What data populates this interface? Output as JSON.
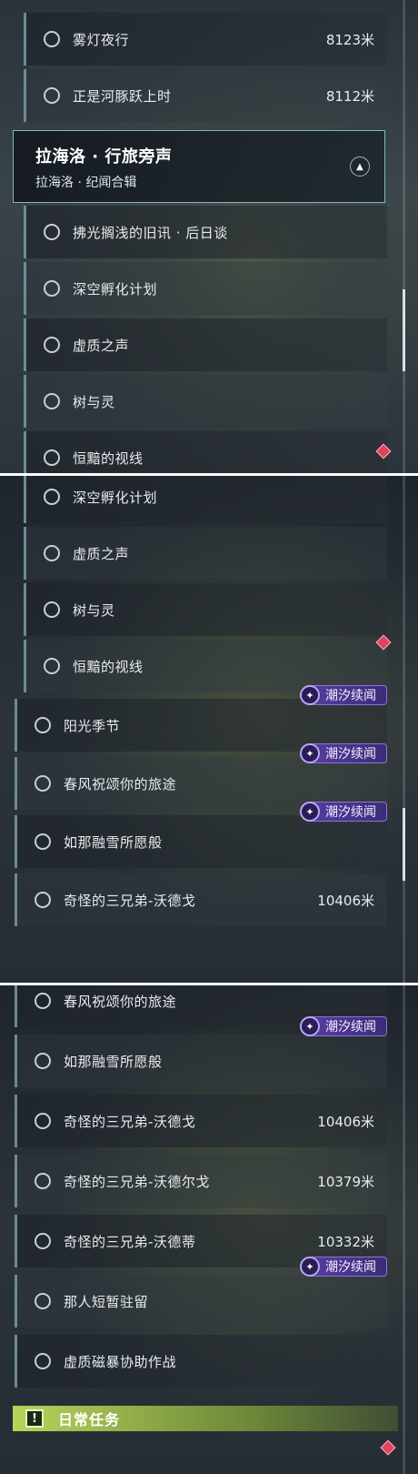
{
  "panel1": {
    "rows_top": [
      {
        "title": "雾灯夜行",
        "distance": "8123米"
      },
      {
        "title": "正是河豚跃上时",
        "distance": "8112米"
      }
    ],
    "section": {
      "title": "拉海洛 · 行旅旁声",
      "subtitle": "拉海洛 · 纪闻合辑"
    },
    "rows": [
      {
        "title": "拂光搁浅的旧讯 · 后日谈"
      },
      {
        "title": "深空孵化计划"
      },
      {
        "title": "虚质之声"
      },
      {
        "title": "树与灵"
      },
      {
        "title": "恒黯的视线"
      }
    ]
  },
  "panel2": {
    "rows": [
      {
        "title": "深空孵化计划"
      },
      {
        "title": "虚质之声"
      },
      {
        "title": "树与灵"
      },
      {
        "title": "恒黯的视线"
      }
    ],
    "quests": [
      {
        "title": "阳光季节",
        "badge": "潮汐续闻"
      },
      {
        "title": "春风祝颂你的旅途",
        "badge": "潮汐续闻"
      },
      {
        "title": "如那融雪所愿般",
        "badge": "潮汐续闻"
      },
      {
        "title": "奇怪的三兄弟-沃德戈",
        "distance": "10406米"
      }
    ]
  },
  "panel3": {
    "quests": [
      {
        "title": "春风祝颂你的旅途"
      },
      {
        "title": "如那融雪所愿般",
        "badge": "潮汐续闻"
      },
      {
        "title": "奇怪的三兄弟-沃德戈",
        "distance": "10406米"
      },
      {
        "title": "奇怪的三兄弟-沃德尔戈",
        "distance": "10379米"
      },
      {
        "title": "奇怪的三兄弟-沃德蒂",
        "distance": "10332米"
      },
      {
        "title": "那人短暂驻留",
        "badge": "潮汐续闻"
      },
      {
        "title": "虚质磁暴协助作战"
      }
    ],
    "daily": {
      "label": "日常任务",
      "icon": "!"
    }
  },
  "colors": {
    "accent": "#7fb6c6",
    "badge": "#5a3fa3",
    "daily": "#b8d35a",
    "marker": "#e2435a"
  }
}
